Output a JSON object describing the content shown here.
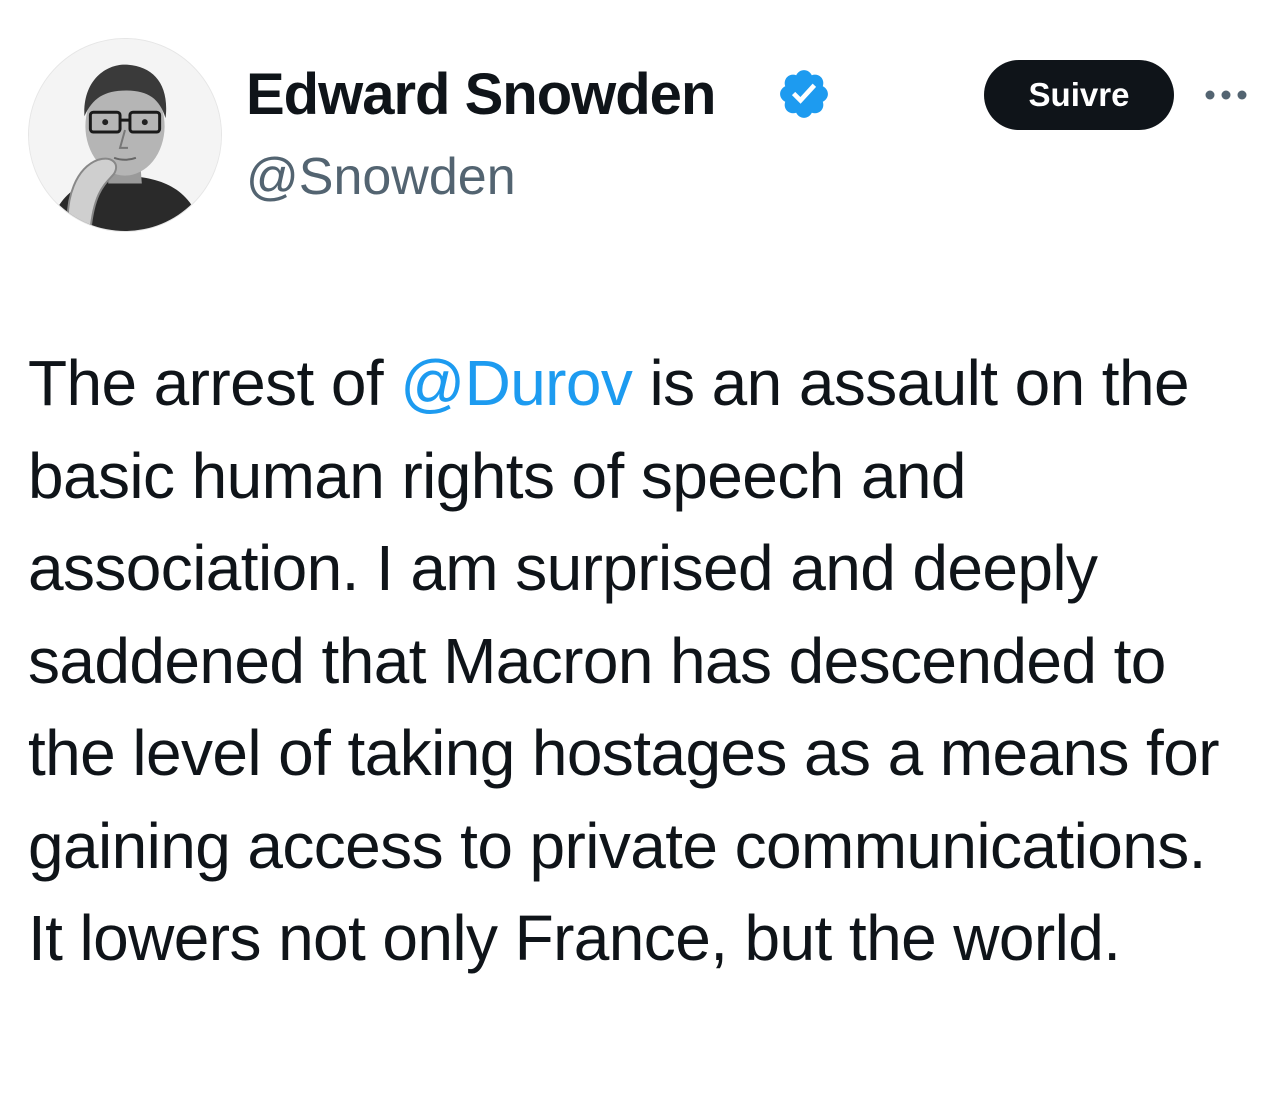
{
  "author": {
    "display_name": "Edward Snowden",
    "handle": "@Snowden",
    "verified": true,
    "avatar_icon": "profile-photo"
  },
  "actions": {
    "follow_label": "Suivre",
    "more_icon": "more-dots-icon"
  },
  "tweet": {
    "text_before_mention": "The arrest of ",
    "mention": "@Durov",
    "text_after_mention": " is an assault on the basic human rights of speech and association. I am surprised and deeply saddened that Macron has descended to the level of taking hostages as a means for gaining access to private communications. It lowers not only France, but the world."
  },
  "colors": {
    "accent": "#1d9bf0",
    "text": "#0f1419",
    "secondary_text": "#536471",
    "follow_button_bg": "#0f1419"
  }
}
